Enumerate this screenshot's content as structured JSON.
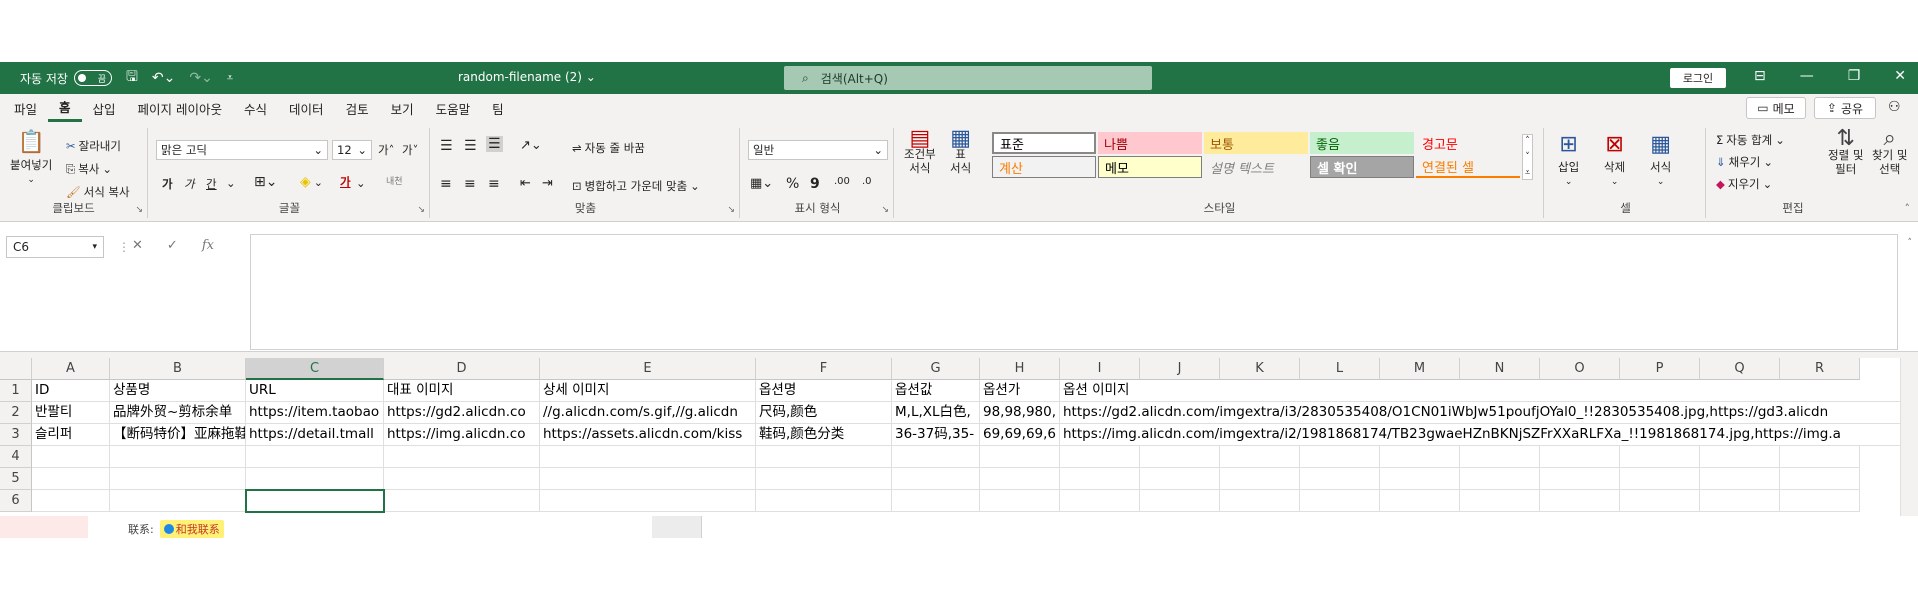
{
  "titlebar": {
    "autosave_label": "자동 저장",
    "autosave_state": "끔",
    "filename": "random-filename (2) ⌄",
    "search_placeholder": "검색(Alt+Q)",
    "login_label": "로그인"
  },
  "menubar": {
    "tabs": [
      "파일",
      "홈",
      "삽입",
      "페이지 레이아웃",
      "수식",
      "데이터",
      "검토",
      "보기",
      "도움말",
      "팀"
    ],
    "active_tab": "홈",
    "memo_label": "메모",
    "share_label": "공유"
  },
  "ribbon": {
    "clipboard": {
      "paste": "붙여넣기",
      "cut": "잘라내기",
      "copy": "복사",
      "format_painter": "서식 복사",
      "label": "클립보드"
    },
    "font": {
      "font_name": "맑은 고딕",
      "font_size": "12",
      "grow": "가˄",
      "shrink": "가˅",
      "bold": "가",
      "italic": "가",
      "underline": "간",
      "font_color_glyph": "가",
      "phonetic": "내천",
      "label": "글꼴"
    },
    "alignment": {
      "wrap_text": "자동 줄 바꿈",
      "merge_center": "병합하고 가운데 맞춤",
      "label": "맞춤"
    },
    "number": {
      "format": "일반",
      "percent": "%",
      "comma": "9",
      "inc_decimal": ".00",
      "dec_decimal": ".0",
      "label": "표시 형식"
    },
    "styles": {
      "conditional_format": "조건부\n서식",
      "format_as_table": "표\n서식",
      "cells": [
        {
          "text": "표준",
          "bg": "#ffffff",
          "color": "#000000"
        },
        {
          "text": "나쁨",
          "bg": "#ffc7ce",
          "color": "#9c0006"
        },
        {
          "text": "보통",
          "bg": "#ffeb9c",
          "color": "#9c5700"
        },
        {
          "text": "좋음",
          "bg": "#c6efce",
          "color": "#006100"
        },
        {
          "text": "경고문",
          "bg": "#f3f2f1",
          "color": "#ff0000"
        },
        {
          "text": "계산",
          "bg": "#f2f2f2",
          "color": "#fa7d00"
        },
        {
          "text": "메모",
          "bg": "#ffffcc",
          "color": "#000000"
        },
        {
          "text": "설명 텍스트",
          "bg": "#f3f2f1",
          "color": "#7f7f7f"
        },
        {
          "text": "셀 확인",
          "bg": "#a5a5a5",
          "color": "#ffffff"
        },
        {
          "text": "연결된 셀",
          "bg": "#f3f2f1",
          "color": "#fa7d00"
        }
      ],
      "label": "스타일"
    },
    "cells_group": {
      "insert": "삽입",
      "delete": "삭제",
      "format": "서식",
      "label": "셀"
    },
    "editing": {
      "autosum": "자동 합계",
      "fill": "채우기",
      "clear": "지우기",
      "sort_filter": "정렬 및\n필터",
      "find_select": "찾기 및\n선택",
      "label": "편집"
    }
  },
  "formula_bar": {
    "name_box": "C6",
    "fx": "fx",
    "value": ""
  },
  "sheet": {
    "columns": [
      "A",
      "B",
      "C",
      "D",
      "E",
      "F",
      "G",
      "H",
      "I",
      "J",
      "K",
      "L",
      "M",
      "N",
      "O",
      "P",
      "Q",
      "R"
    ],
    "selected_column": "C",
    "rows": [
      {
        "num": "1",
        "cells": [
          "ID",
          "상품명",
          "URL",
          "대표 이미지",
          "상세 이미지",
          "옵션명",
          "옵션값",
          "옵션가",
          "옵션 이미지"
        ]
      },
      {
        "num": "2",
        "cells": [
          "반팔티",
          "品牌外贸~剪标余单",
          "https://item.taobao",
          "https://gd2.alicdn.co",
          "//g.alicdn.com/s.gif,//g.alicdn",
          "尺码,颜色",
          "M,L,XL白色,",
          "98,98,980,",
          "https://gd2.alicdn.com/imgextra/i3/2830535408/O1CN01iWbJw51poufjOYal0_!!2830535408.jpg,https://gd3.alicdn"
        ]
      },
      {
        "num": "3",
        "cells": [
          "슬리퍼",
          "【断码特价】亚麻拖鞋",
          "https://detail.tmall",
          "https://img.alicdn.co",
          "https://assets.alicdn.com/kiss",
          "鞋码,颜色分类",
          "36-37码,35-",
          "69,69,69,6",
          "https://img.alicdn.com/imgextra/i2/1981868174/TB23gwaeHZnBKNjSZFrXXaRLFXa_!!1981868174.jpg,https://img.a"
        ]
      },
      {
        "num": "4",
        "cells": []
      },
      {
        "num": "5",
        "cells": []
      },
      {
        "num": "6",
        "cells": []
      }
    ]
  },
  "footer": {
    "contact_label": "联系:",
    "contact_badge": "和我联系"
  }
}
